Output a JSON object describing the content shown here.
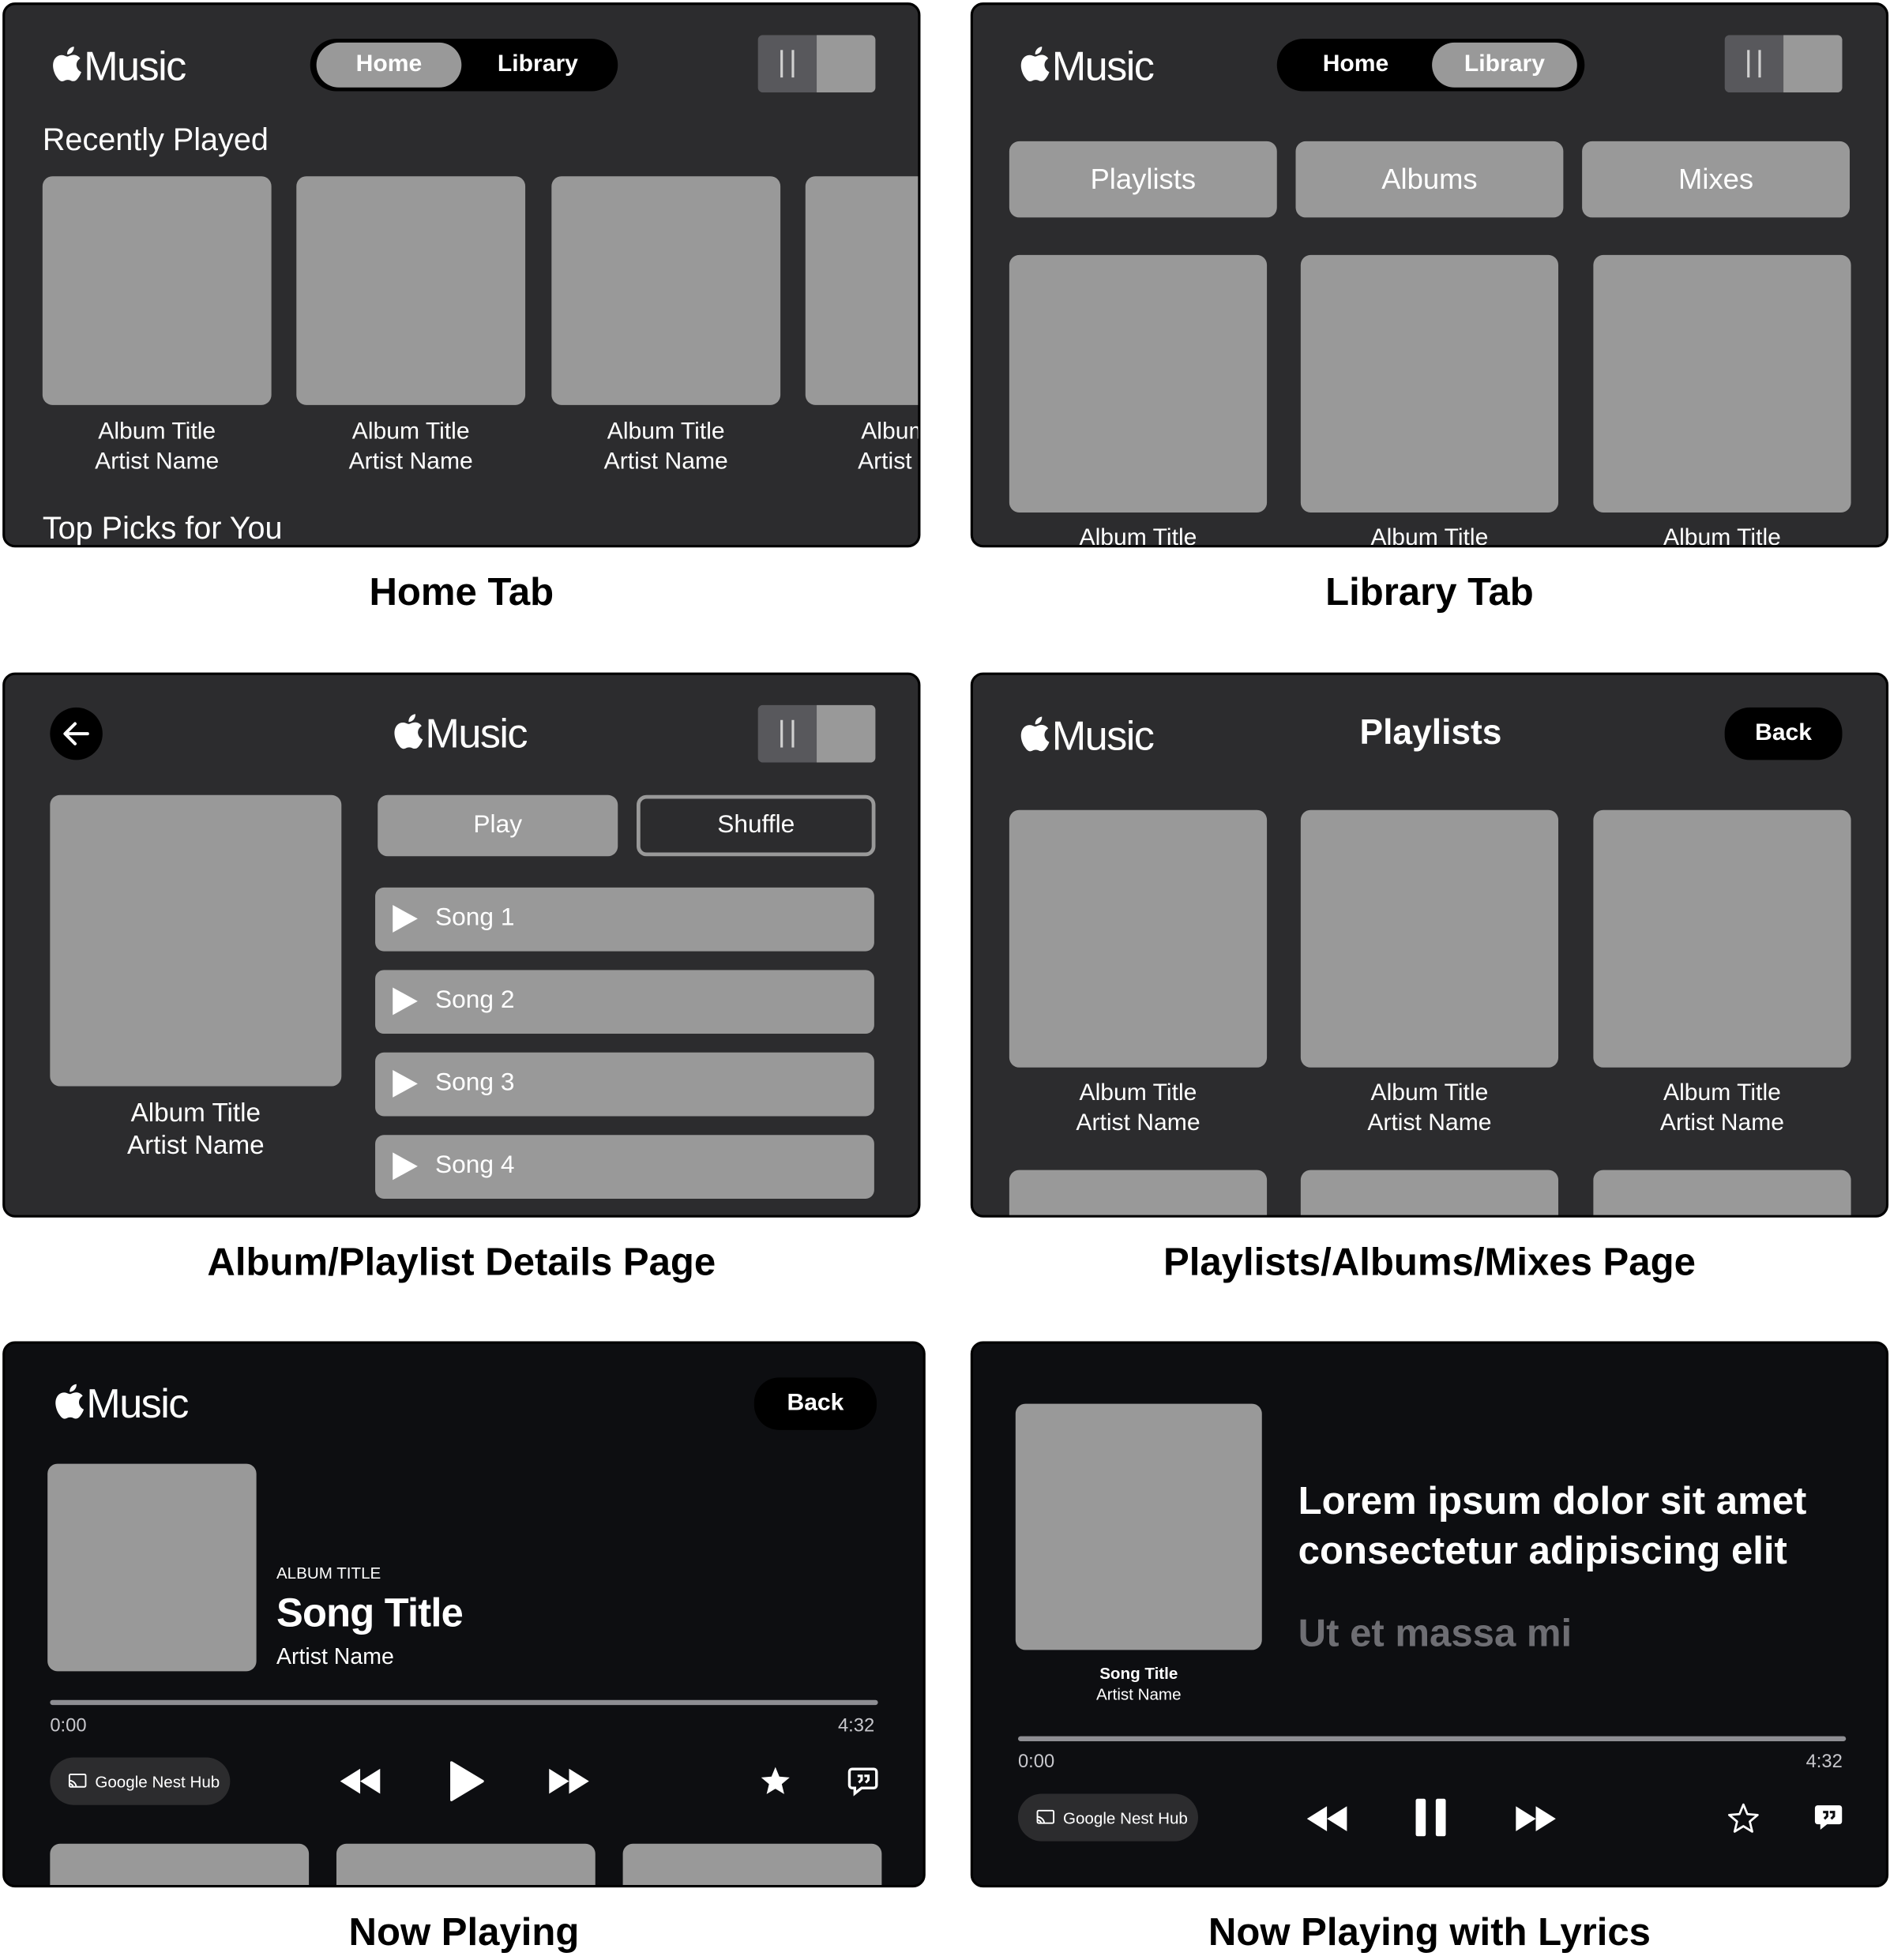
{
  "app": {
    "logo_text": "Music"
  },
  "home": {
    "tabs": [
      "Home",
      "Library"
    ],
    "recently_played_title": "Recently Played",
    "albums": [
      {
        "title": "Album Title",
        "artist": "Artist Name"
      },
      {
        "title": "Album Title",
        "artist": "Artist Name"
      },
      {
        "title": "Album Title",
        "artist": "Artist Name"
      },
      {
        "title": "Album Title",
        "artist": "Artist Name"
      }
    ],
    "top_picks_title": "Top Picks for You",
    "caption": "Home Tab"
  },
  "library": {
    "tabs": [
      "Home",
      "Library"
    ],
    "categories": [
      "Playlists",
      "Albums",
      "Mixes"
    ],
    "albums": [
      "Album Title",
      "Album Title",
      "Album Title"
    ],
    "caption": "Library Tab"
  },
  "details": {
    "album_title": "Album Title",
    "artist": "Artist Name",
    "play_label": "Play",
    "shuffle_label": "Shuffle",
    "songs": [
      "Song 1",
      "Song 2",
      "Song 3",
      "Song 4"
    ],
    "caption": "Album/Playlist Details Page"
  },
  "playlists": {
    "title": "Playlists",
    "back_label": "Back",
    "items": [
      {
        "title": "Album Title",
        "artist": "Artist Name"
      },
      {
        "title": "Album Title",
        "artist": "Artist Name"
      },
      {
        "title": "Album Title",
        "artist": "Artist Name"
      }
    ],
    "caption": "Playlists/Albums/Mixes Page"
  },
  "now_playing": {
    "back_label": "Back",
    "album_title": "ALBUM TITLE",
    "song_title": "Song Title",
    "artist": "Artist Name",
    "time_start": "0:00",
    "time_end": "4:32",
    "cast_device": "Google Nest Hub",
    "caption": "Now Playing"
  },
  "lyrics": {
    "song_title": "Song Title",
    "artist": "Artist Name",
    "lyric_current": "Lorem ipsum dolor sit amet consectetur adipiscing elit",
    "lyric_next": "Ut et massa mi",
    "time_start": "0:00",
    "time_end": "4:32",
    "cast_device": "Google Nest Hub",
    "caption": "Now Playing with Lyrics"
  },
  "colors": {
    "screen_gray": "#2c2c2e",
    "screen_black": "#0d0e11",
    "placeholder": "#999999",
    "accent_black": "#000000"
  },
  "icons": [
    "apple-logo-icon",
    "pause-bars-icon",
    "back-arrow-icon",
    "play-triangle-icon",
    "rewind-icon",
    "play-icon",
    "pause-icon",
    "fast-forward-icon",
    "star-icon",
    "lyrics-bubble-icon",
    "cast-icon"
  ]
}
